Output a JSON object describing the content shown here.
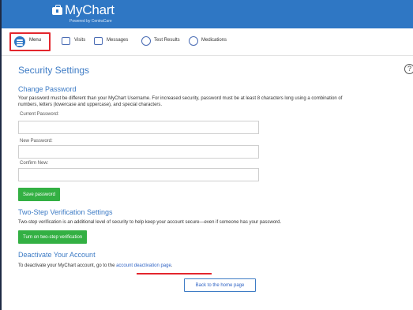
{
  "header": {
    "app_name": "MyChart",
    "powered_by": "Powered by CentraCare"
  },
  "nav": {
    "menu_label": "Menu",
    "items": [
      {
        "label": "Visits",
        "icon": "calendar-icon"
      },
      {
        "label": "Messages",
        "icon": "envelope-icon"
      },
      {
        "label": "Test Results",
        "icon": "flask-icon"
      },
      {
        "label": "Medications",
        "icon": "pill-icon"
      }
    ]
  },
  "page": {
    "title": "Security Settings",
    "help_glyph": "?"
  },
  "change_password": {
    "heading": "Change Password",
    "description_line1": "Your password must be different than your MyChart Username. For increased security, password must be at least 8 characters long using a combination of",
    "description_line2": "numbers, letters (lowercase and uppercase), and special characters.",
    "current_label": "Current Password:",
    "new_label": "New Password:",
    "confirm_label": "Confirm New:",
    "current_value": "",
    "new_value": "",
    "confirm_value": "",
    "save_button": "Save password"
  },
  "two_step": {
    "heading": "Two-Step Verification Settings",
    "description": "Two-step verification is an additional level of security to help keep your account secure—even if someone has your password.",
    "button": "Turn on two-step verification"
  },
  "deactivate": {
    "heading": "Deactivate Your Account",
    "text_prefix": "To deactivate your MyChart account, go to the ",
    "link_text": "account deactivation page",
    "text_suffix": "."
  },
  "footer": {
    "back_button": "Back to the home page"
  },
  "colors": {
    "brand_blue": "#2f77c4",
    "heading_blue": "#3d7bc5",
    "button_green": "#33b043",
    "highlight_red": "#e3262d"
  }
}
